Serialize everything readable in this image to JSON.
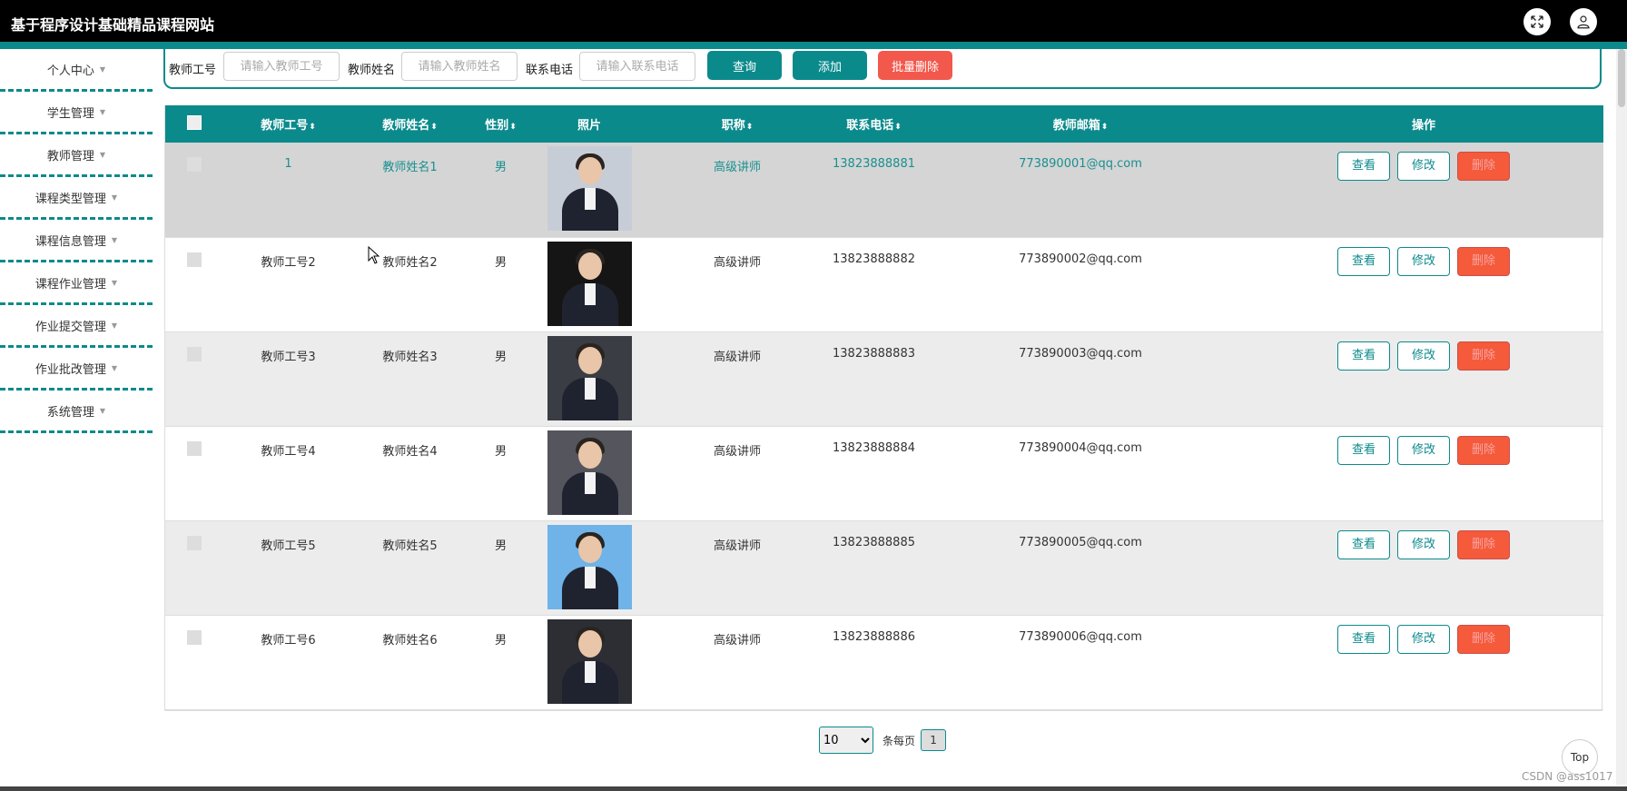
{
  "header": {
    "title": "基于程序设计基础精品课程网站",
    "fullscreen_icon": "fullscreen-icon",
    "user_icon": "user-icon"
  },
  "sidebar": {
    "items": [
      {
        "label": "个人中心"
      },
      {
        "label": "学生管理"
      },
      {
        "label": "教师管理"
      },
      {
        "label": "课程类型管理"
      },
      {
        "label": "课程信息管理"
      },
      {
        "label": "课程作业管理"
      },
      {
        "label": "作业提交管理"
      },
      {
        "label": "作业批改管理"
      },
      {
        "label": "系统管理"
      }
    ]
  },
  "search": {
    "fields": [
      {
        "label": "教师工号",
        "placeholder": "请输入教师工号"
      },
      {
        "label": "教师姓名",
        "placeholder": "请输入教师姓名"
      },
      {
        "label": "联系电话",
        "placeholder": "请输入联系电话"
      }
    ],
    "query_label": "查询",
    "add_label": "添加",
    "batch_delete_label": "批量删除"
  },
  "table": {
    "columns": [
      {
        "label": ""
      },
      {
        "label": "教师工号",
        "sortable": true
      },
      {
        "label": "教师姓名",
        "sortable": true
      },
      {
        "label": "性别",
        "sortable": true
      },
      {
        "label": "照片"
      },
      {
        "label": "职称",
        "sortable": true
      },
      {
        "label": "联系电话",
        "sortable": true
      },
      {
        "label": "教师邮箱",
        "sortable": true
      },
      {
        "label": "操作"
      }
    ],
    "action_labels": {
      "view": "查看",
      "edit": "修改",
      "delete": "删除"
    },
    "rows": [
      {
        "id": "1",
        "name": "教师姓名1",
        "gender": "男",
        "title": "高级讲师",
        "phone": "13823888881",
        "email": "773890001@qq.com"
      },
      {
        "id": "教师工号2",
        "name": "教师姓名2",
        "gender": "男",
        "title": "高级讲师",
        "phone": "13823888882",
        "email": "773890002@qq.com"
      },
      {
        "id": "教师工号3",
        "name": "教师姓名3",
        "gender": "男",
        "title": "高级讲师",
        "phone": "13823888883",
        "email": "773890003@qq.com"
      },
      {
        "id": "教师工号4",
        "name": "教师姓名4",
        "gender": "男",
        "title": "高级讲师",
        "phone": "13823888884",
        "email": "773890004@qq.com"
      },
      {
        "id": "教师工号5",
        "name": "教师姓名5",
        "gender": "男",
        "title": "高级讲师",
        "phone": "13823888885",
        "email": "773890005@qq.com"
      },
      {
        "id": "教师工号6",
        "name": "教师姓名6",
        "gender": "男",
        "title": "高级讲师",
        "phone": "13823888886",
        "email": "773890006@qq.com"
      }
    ]
  },
  "pagination": {
    "page_size": "10",
    "per_page_label": "条每页",
    "current_page": "1"
  },
  "top_label": "Top",
  "watermark": "CSDN @ass1017",
  "colors": {
    "accent": "#0b8a8c",
    "danger": "#f55a3a",
    "header_bg": "#000000"
  }
}
